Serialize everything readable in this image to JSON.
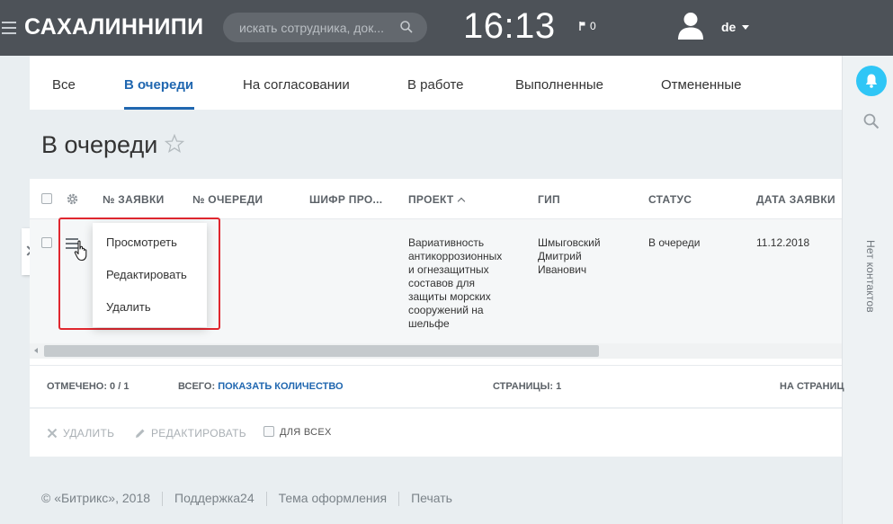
{
  "header": {
    "brand": "САХАЛИННИПИ",
    "search_placeholder": "искать сотрудника, док...",
    "clock": "16:13",
    "flag_count": "0",
    "username": "de"
  },
  "tabs": [
    {
      "label": "Все"
    },
    {
      "label": "В очереди"
    },
    {
      "label": "На согласовании"
    },
    {
      "label": "В работе"
    },
    {
      "label": "Выполненные"
    },
    {
      "label": "Отмененные"
    }
  ],
  "page_title": "В очереди",
  "grid": {
    "columns": [
      "№ ЗАЯВКИ",
      "№ ОЧЕРЕДИ",
      "ШИФР ПРО...",
      "ПРОЕКТ",
      "ГИП",
      "СТАТУС",
      "ДАТА ЗАЯВКИ"
    ],
    "row": {
      "project_lines": [
        "Вариативность",
        "антикоррозионных",
        "и огнезащитных",
        "составов для",
        "защиты морских",
        "сооружений на",
        "шельфе"
      ],
      "gip_lines": [
        "Шмыговский",
        "Дмитрий",
        "Иванович"
      ],
      "status": "В очереди",
      "date": "11.12.2018"
    },
    "context_menu": [
      "Просмотреть",
      "Редактировать",
      "Удалить"
    ]
  },
  "footer_bar": {
    "selected_label": "ОТМЕЧЕНО: 0 / 1",
    "total_label": "ВСЕГО:",
    "show_count_link": "ПОКАЗАТЬ КОЛИЧЕСТВО",
    "pages_label": "СТРАНИЦЫ: 1",
    "per_page_label": "НА СТРАНИЦ"
  },
  "actions": {
    "delete": "УДАЛИТЬ",
    "edit": "РЕДАКТИРОВАТЬ",
    "for_all": "ДЛЯ ВСЕХ"
  },
  "right_panel": {
    "no_contacts": "Нет контактов"
  },
  "page_footer": {
    "copyright": "© «Битрикс», 2018",
    "support": "Поддержка24",
    "theme": "Тема оформления",
    "print": "Печать"
  },
  "colors": {
    "header_bg": "#4d5258",
    "accent": "#2067b0",
    "bell": "#2fc6f6",
    "highlight": "#e0272f"
  }
}
